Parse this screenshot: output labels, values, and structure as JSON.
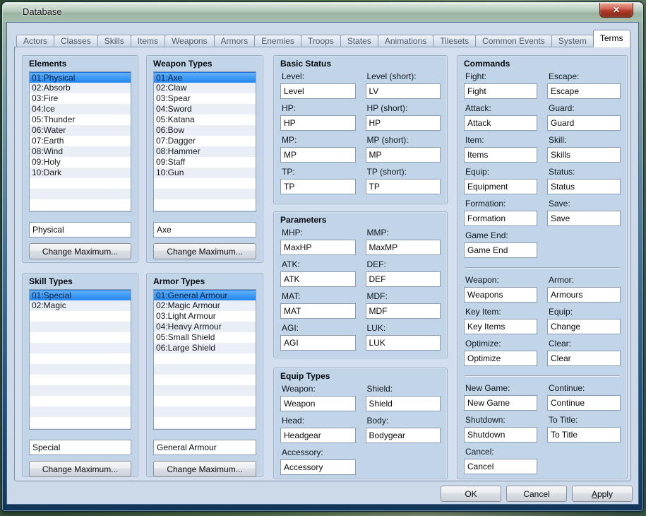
{
  "window": {
    "title": "Database",
    "close_icon": "✕"
  },
  "colors": {
    "selection_blue": "#2486f0",
    "close_red": "#b23c2b",
    "dialog_bg": "#ccd9e9",
    "group_bg": "#c2d4e7"
  },
  "tabs": {
    "items": [
      "Actors",
      "Classes",
      "Skills",
      "Items",
      "Weapons",
      "Armors",
      "Enemies",
      "Troops",
      "States",
      "Animations",
      "Tilesets",
      "Common Events",
      "System",
      "Terms"
    ],
    "active": "Terms"
  },
  "groups": {
    "elements": {
      "title": "Elements",
      "items": [
        "01:Physical",
        "02:Absorb",
        "03:Fire",
        "04:Ice",
        "05:Thunder",
        "06:Water",
        "07:Earth",
        "08:Wind",
        "09:Holy",
        "10:Dark"
      ],
      "selected": 0,
      "field": "Physical",
      "button": "Change Maximum..."
    },
    "weapon_types": {
      "title": "Weapon Types",
      "items": [
        "01:Axe",
        "02:Claw",
        "03:Spear",
        "04:Sword",
        "05:Katana",
        "06:Bow",
        "07:Dagger",
        "08:Hammer",
        "09:Staff",
        "10:Gun"
      ],
      "selected": 0,
      "field": "Axe",
      "button": "Change Maximum..."
    },
    "skill_types": {
      "title": "Skill Types",
      "items": [
        "01:Special",
        "02:Magic"
      ],
      "selected": 0,
      "field": "Special",
      "button": "Change Maximum..."
    },
    "armor_types": {
      "title": "Armor Types",
      "items": [
        "01:General Armour",
        "02:Magic Armour",
        "03:Light Armour",
        "04:Heavy Armour",
        "05:Small Shield",
        "06:Large Shield"
      ],
      "selected": 0,
      "field": "General Armour",
      "button": "Change Maximum..."
    },
    "basic_status": {
      "title": "Basic Status",
      "fields": [
        {
          "label": "Level:",
          "value": "Level"
        },
        {
          "label": "Level (short):",
          "value": "LV"
        },
        {
          "label": "HP:",
          "value": "HP"
        },
        {
          "label": "HP (short):",
          "value": "HP"
        },
        {
          "label": "MP:",
          "value": "MP"
        },
        {
          "label": "MP (short):",
          "value": "MP"
        },
        {
          "label": "TP:",
          "value": "TP"
        },
        {
          "label": "TP (short):",
          "value": "TP"
        }
      ]
    },
    "parameters": {
      "title": "Parameters",
      "fields": [
        {
          "label": "MHP:",
          "value": "MaxHP"
        },
        {
          "label": "MMP:",
          "value": "MaxMP"
        },
        {
          "label": "ATK:",
          "value": "ATK"
        },
        {
          "label": "DEF:",
          "value": "DEF"
        },
        {
          "label": "MAT:",
          "value": "MAT"
        },
        {
          "label": "MDF:",
          "value": "MDF"
        },
        {
          "label": "AGI:",
          "value": "AGI"
        },
        {
          "label": "LUK:",
          "value": "LUK"
        }
      ]
    },
    "equip_types": {
      "title": "Equip Types",
      "fields": [
        {
          "label": "Weapon:",
          "value": "Weapon"
        },
        {
          "label": "Shield:",
          "value": "Shield"
        },
        {
          "label": "Head:",
          "value": "Headgear"
        },
        {
          "label": "Body:",
          "value": "Bodygear"
        },
        {
          "label": "Accessory:",
          "value": "Accessory"
        }
      ]
    },
    "commands": {
      "title": "Commands",
      "sections": [
        [
          {
            "label": "Fight:",
            "value": "Fight"
          },
          {
            "label": "Escape:",
            "value": "Escape"
          },
          {
            "label": "Attack:",
            "value": "Attack"
          },
          {
            "label": "Guard:",
            "value": "Guard"
          },
          {
            "label": "Item:",
            "value": "Items"
          },
          {
            "label": "Skill:",
            "value": "Skills"
          },
          {
            "label": "Equip:",
            "value": "Equipment"
          },
          {
            "label": "Status:",
            "value": "Status"
          },
          {
            "label": "Formation:",
            "value": "Formation"
          },
          {
            "label": "Save:",
            "value": "Save"
          },
          {
            "label": "Game End:",
            "value": "Game End"
          }
        ],
        [
          {
            "label": "Weapon:",
            "value": "Weapons"
          },
          {
            "label": "Armor:",
            "value": "Armours"
          },
          {
            "label": "Key Item:",
            "value": "Key Items"
          },
          {
            "label": "Equip:",
            "value": "Change"
          },
          {
            "label": "Optimize:",
            "value": "Optimize"
          },
          {
            "label": "Clear:",
            "value": "Clear"
          }
        ],
        [
          {
            "label": "New Game:",
            "value": "New Game"
          },
          {
            "label": "Continue:",
            "value": "Continue"
          },
          {
            "label": "Shutdown:",
            "value": "Shutdown"
          },
          {
            "label": "To Title:",
            "value": "To Title"
          },
          {
            "label": "Cancel:",
            "value": "Cancel"
          }
        ]
      ]
    }
  },
  "footer": {
    "ok": "OK",
    "cancel": "Cancel",
    "apply": "Apply"
  }
}
